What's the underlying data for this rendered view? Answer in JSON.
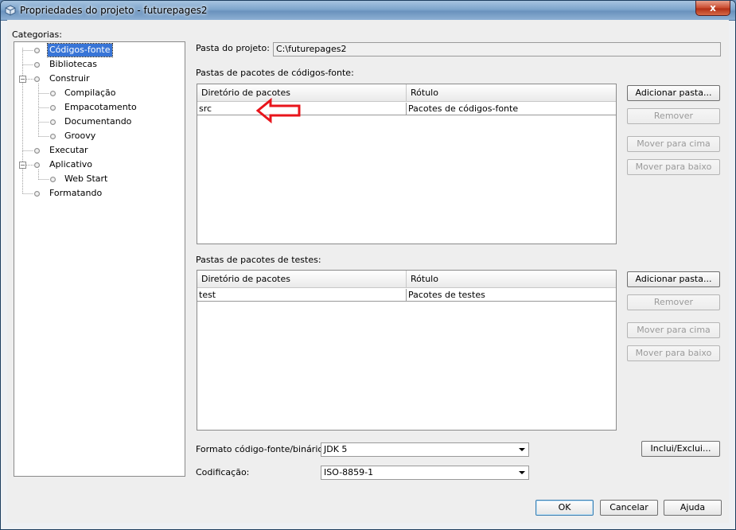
{
  "window": {
    "title": "Propriedades do projeto - futurepages2",
    "close_glyph": "x"
  },
  "categories": {
    "label": "Categorias:",
    "items": [
      {
        "label": "Códigos-fonte",
        "selected": true
      },
      {
        "label": "Bibliotecas"
      },
      {
        "label": "Construir",
        "expanded": true
      },
      {
        "label": "Compilação"
      },
      {
        "label": "Empacotamento"
      },
      {
        "label": "Documentando"
      },
      {
        "label": "Groovy"
      },
      {
        "label": "Executar"
      },
      {
        "label": "Aplicativo",
        "expanded": true
      },
      {
        "label": "Web Start"
      },
      {
        "label": "Formatando"
      }
    ],
    "collapse_glyph": "−"
  },
  "project_folder": {
    "label": "Pasta do projeto:",
    "value": "C:\\futurepages2"
  },
  "source_packages": {
    "label": "Pastas de pacotes de códigos-fonte:",
    "columns": [
      "Diretório de pacotes",
      "Rótulo"
    ],
    "rows": [
      {
        "dir": "src",
        "label": "Pacotes de códigos-fonte"
      }
    ],
    "buttons": {
      "add": "Adicionar pasta...",
      "remove": "Remover",
      "up": "Mover para cima",
      "down": "Mover para baixo"
    }
  },
  "test_packages": {
    "label": "Pastas de pacotes de testes:",
    "columns": [
      "Diretório de pacotes",
      "Rótulo"
    ],
    "rows": [
      {
        "dir": "test",
        "label": "Pacotes de testes"
      }
    ],
    "buttons": {
      "add": "Adicionar pasta...",
      "remove": "Remover",
      "up": "Mover para cima",
      "down": "Mover para baixo"
    }
  },
  "source_format": {
    "label": "Formato código-fonte/binário:",
    "value": "JDK 5"
  },
  "encoding": {
    "label": "Codificação:",
    "value": "ISO-8859-1"
  },
  "include_exclude": "Inclui/Exclui...",
  "footer": {
    "ok": "OK",
    "cancel": "Cancelar",
    "help": "Ajuda"
  },
  "colors": {
    "selection": "#3875d7",
    "annotation_arrow": "#e8141b"
  }
}
